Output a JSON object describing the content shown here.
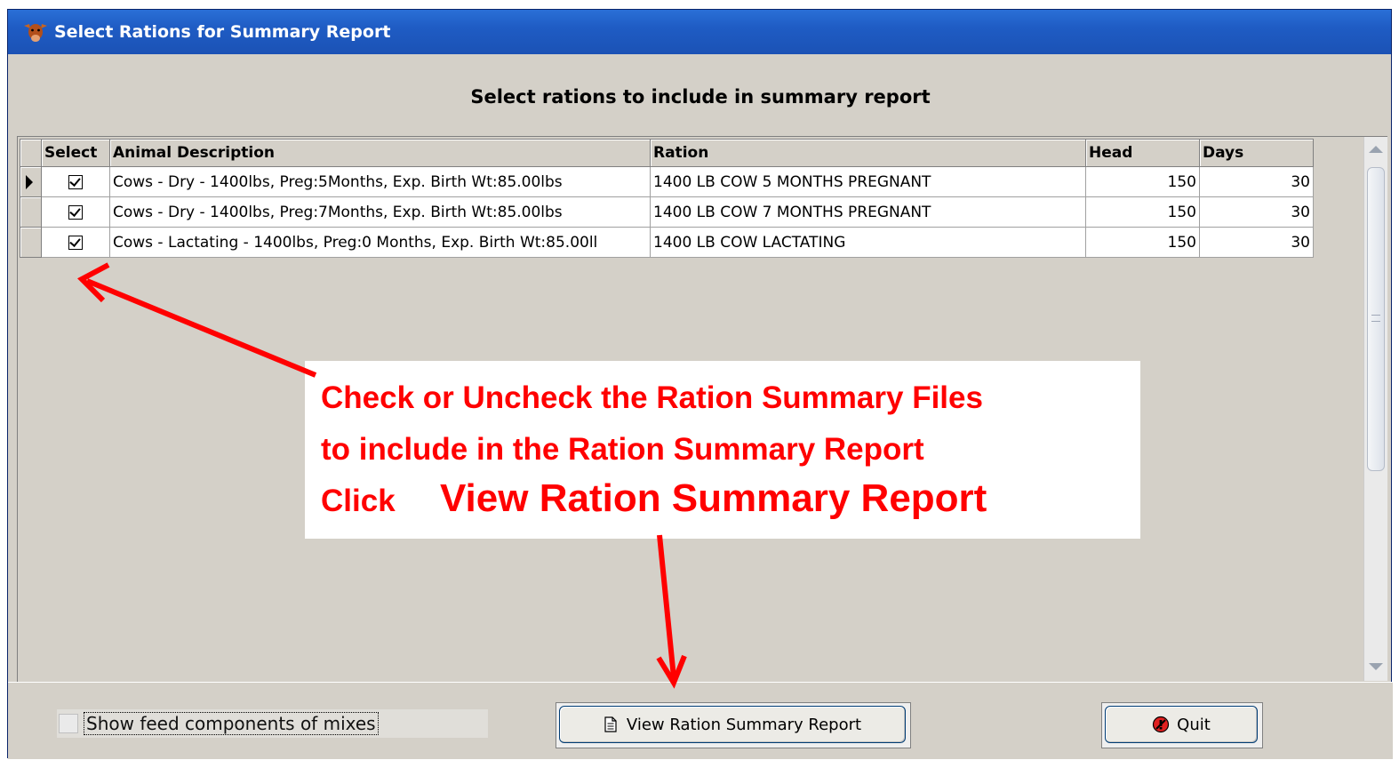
{
  "window": {
    "title": "Select Rations for Summary Report"
  },
  "heading": "Select rations to include in summary report",
  "grid": {
    "columns": {
      "select": "Select",
      "animal": "Animal Description",
      "ration": "Ration",
      "head": "Head",
      "days": "Days"
    },
    "rows": [
      {
        "selected": true,
        "animal": "Cows - Dry - 1400lbs, Preg:5Months, Exp. Birth Wt:85.00lbs",
        "ration": "1400 LB COW 5 MONTHS PREGNANT",
        "head": "150",
        "days": "30"
      },
      {
        "selected": true,
        "animal": "Cows - Dry - 1400lbs, Preg:7Months, Exp. Birth Wt:85.00lbs",
        "ration": "1400 LB COW 7 MONTHS PREGNANT",
        "head": "150",
        "days": "30"
      },
      {
        "selected": true,
        "animal": "Cows - Lactating - 1400lbs, Preg:0 Months, Exp. Birth Wt:85.00ll",
        "ration": "1400 LB COW LACTATING",
        "head": "150",
        "days": "30"
      }
    ]
  },
  "annotation": {
    "line1": "Check or Uncheck the Ration Summary Files",
    "line2": "to include in the Ration Summary Report",
    "line3a": "Click",
    "line3b": "View Ration Summary Report",
    "color": "#ff0000"
  },
  "bottom": {
    "show_feed_label": "Show feed components of mixes",
    "view_button": "View Ration Summary Report",
    "quit_button": "Quit"
  }
}
